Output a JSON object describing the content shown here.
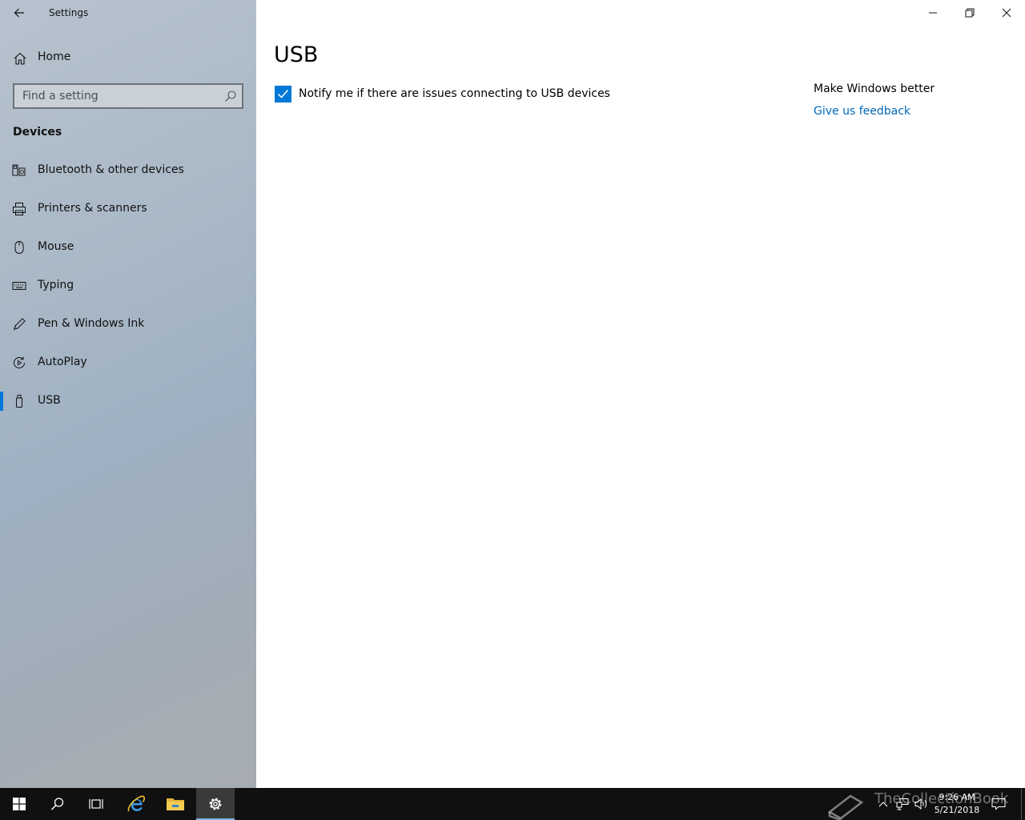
{
  "window": {
    "app_title": "Settings"
  },
  "sidebar": {
    "home_label": "Home",
    "search_placeholder": "Find a setting",
    "section_heading": "Devices",
    "items": [
      {
        "label": "Bluetooth & other devices",
        "icon": "bluetooth-devices-icon"
      },
      {
        "label": "Printers & scanners",
        "icon": "printer-icon"
      },
      {
        "label": "Mouse",
        "icon": "mouse-icon"
      },
      {
        "label": "Typing",
        "icon": "keyboard-icon"
      },
      {
        "label": "Pen & Windows Ink",
        "icon": "pen-icon"
      },
      {
        "label": "AutoPlay",
        "icon": "autoplay-icon"
      },
      {
        "label": "USB",
        "icon": "usb-icon",
        "selected": true
      }
    ]
  },
  "main": {
    "title": "USB",
    "notify_checkbox": {
      "label": "Notify me if there are issues connecting to USB devices",
      "checked": true
    },
    "side_panel": {
      "title": "Make Windows better",
      "link": "Give us feedback"
    }
  },
  "taskbar": {
    "time": "9:26 AM",
    "date": "5/21/2018",
    "watermark": "TheCollectionBook"
  },
  "colors": {
    "accent": "#0078d7",
    "link": "#0067b8",
    "taskbar": "#101010"
  }
}
